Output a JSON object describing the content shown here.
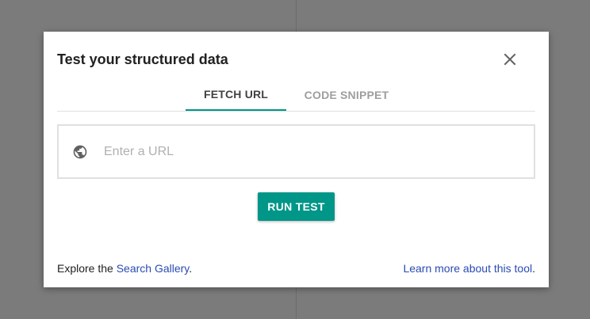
{
  "dialog": {
    "title": "Test your structured data",
    "close_icon": "close-icon"
  },
  "tabs": [
    {
      "label": "FETCH URL",
      "active": true
    },
    {
      "label": "CODE SNIPPET",
      "active": false
    }
  ],
  "url_input": {
    "icon": "globe-icon",
    "value": "",
    "placeholder": "Enter a URL"
  },
  "run_button": {
    "label": "RUN TEST"
  },
  "footer": {
    "left_prefix": "Explore the ",
    "left_link": "Search Gallery",
    "left_suffix": ".",
    "right_link": "Learn more about this tool",
    "right_suffix": "."
  },
  "colors": {
    "accent": "#009688",
    "link": "#2a4bb3",
    "backdrop": "#7b7b7b"
  }
}
